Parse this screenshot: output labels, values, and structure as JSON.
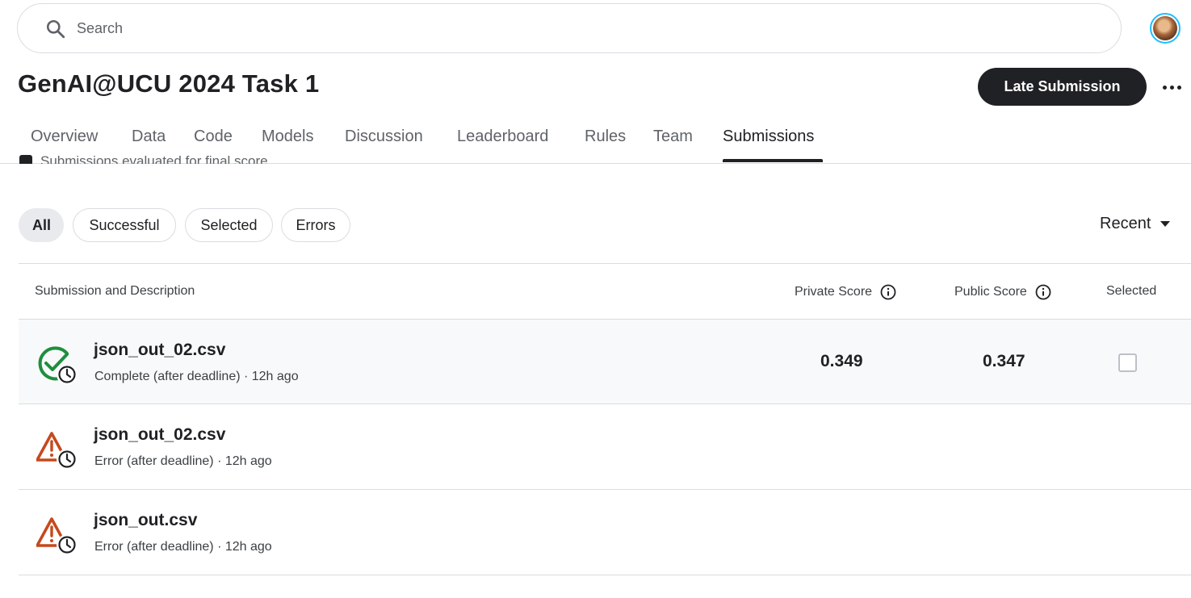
{
  "search": {
    "placeholder": "Search"
  },
  "header": {
    "title": "GenAI@UCU 2024 Task 1",
    "late_submission_label": "Late Submission"
  },
  "tabs": [
    {
      "label": "Overview"
    },
    {
      "label": "Data"
    },
    {
      "label": "Code"
    },
    {
      "label": "Models"
    },
    {
      "label": "Discussion"
    },
    {
      "label": "Leaderboard"
    },
    {
      "label": "Rules"
    },
    {
      "label": "Team"
    },
    {
      "label": "Submissions",
      "active": true
    }
  ],
  "clipped_text": "Submissions evaluated for final score",
  "filters": [
    {
      "label": "All",
      "active": true
    },
    {
      "label": "Successful"
    },
    {
      "label": "Selected"
    },
    {
      "label": "Errors"
    }
  ],
  "sort": {
    "label": "Recent"
  },
  "table": {
    "headers": {
      "submission": "Submission and Description",
      "private": "Private Score",
      "public": "Public Score",
      "selected": "Selected"
    },
    "rows": [
      {
        "name": "json_out_02.csv",
        "description": "Complete (after deadline) · 12h ago",
        "status": "complete",
        "private_score": "0.349",
        "public_score": "0.347",
        "selected": false
      },
      {
        "name": "json_out_02.csv",
        "description": "Error (after deadline) · 12h ago",
        "status": "error"
      },
      {
        "name": "json_out.csv",
        "description": "Error (after deadline) · 12h ago",
        "status": "error"
      }
    ]
  },
  "icons": {
    "search": "search-icon",
    "info": "info-icon",
    "complete": "check-circle-icon",
    "error": "warning-triangle-icon",
    "clock": "clock-icon",
    "more": "more-horizontal-icon"
  },
  "colors": {
    "success": "#1e8e3e",
    "error": "#c5491d",
    "button_bg": "#202124",
    "avatar_ring": "#20beff"
  }
}
